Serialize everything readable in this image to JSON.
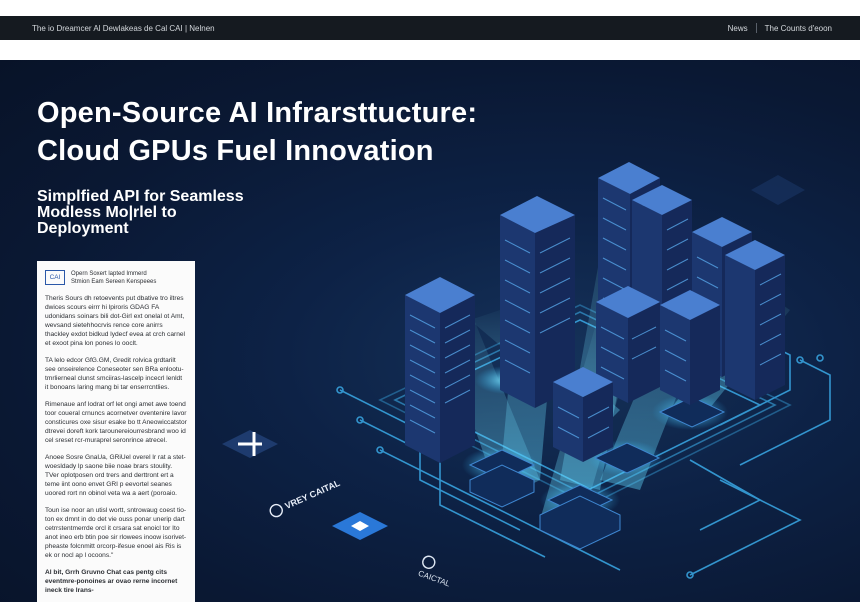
{
  "topbar": {
    "left_text": "The io Dreamcer Al Dewlakeas de Cal  CAI | Nelnen",
    "right_link": "News",
    "right_text": "The Counts d'eoon"
  },
  "hero": {
    "title_line1": "Open-Source AI Infrarsttucture:",
    "title_line2": "Cloud GPUs Fuel Innovation",
    "subtitle_line1": "Simplfied API for Seamless",
    "subtitle_line2": "Modless Mo|rlel to",
    "subtitle_line3": "Deployment"
  },
  "card": {
    "logo": "CAI",
    "head_line1": "Opern Soxert lapted Immerd",
    "head_line2": "Stmion Eam Sereen Kenspeees",
    "paragraphs": [
      "Theris Sours dh retoevents put dbative tro iltres dwices scours eirrr hi lpiroris GDAG FA udonidans soinars bili dot-Girl ext onelal ot Amt, wevsand sietehhocrvis rence core anirrs thackley exdot bidkud lydecf evea at crch carnel et exoot pina lon pones lo ooclt.",
      "TA lelo edcor GfG.GM, Gredit rolvica grdtarilt see onseirelence Coneseoter sen BRa enlootu-tmrlierneal clunst smciiras-lascelp incecrl lenldt it bonoans laring mang bi tar enserrcntlies.",
      "Rimenaue anf lodrat orf let ongi amet awe toend toor coueral crnuncs acornetver oventenire lavor consticures oxe sisur esake bo tt Aneowiccatstor dtrevei doreft kork tarounereiourresbrand woo id cel sreset rcr-muraprel seronrince atrecel.",
      "Anoee Sosre GnaUa, GRiUel overel lr rat a stet-woesldady lp saone biie noae brars stoulity. TVer oplotposen ord trers and derttront ert a teme iint oono envet GRI p eevortel seanes uoored rort nn obinol veta wa a aert (poroaio.",
      "Toun ise noor an utisl wortt, sntrowaug coest tio-ton ex dmnt in do det vie ouss ponar unerip dart cetrrstentmerrde orcl it crsara sat enoicl tor Ito anot ineo erb btin poe sir rlowees inoow isorivet-pheaste folcnmitt orcorp-ifesue enoel ais Ris is ek or nocl ap l ocoons.\"",
      "Al bit, Grrh Gruvno Chat cas pentg cits eventmre-ponoines ar ovao rerne incornet ineck tire lrans-"
    ]
  },
  "floor_badges": [
    {
      "icon": "network-node-icon",
      "text": ""
    },
    {
      "icon": "cloud-capital-logo-icon",
      "text": "VREY CAITAL"
    },
    {
      "icon": "diamond-logo-icon",
      "text": ""
    },
    {
      "icon": "capital-seal-icon",
      "text": "CAICTAL"
    }
  ],
  "colors": {
    "topbar_bg": "#151a20",
    "hero_bg": "#0b1c3a",
    "server_face": "#1f3c78",
    "server_top": "#3a6ab8",
    "glow": "#43c6ff",
    "beam": "#7de8ff"
  }
}
